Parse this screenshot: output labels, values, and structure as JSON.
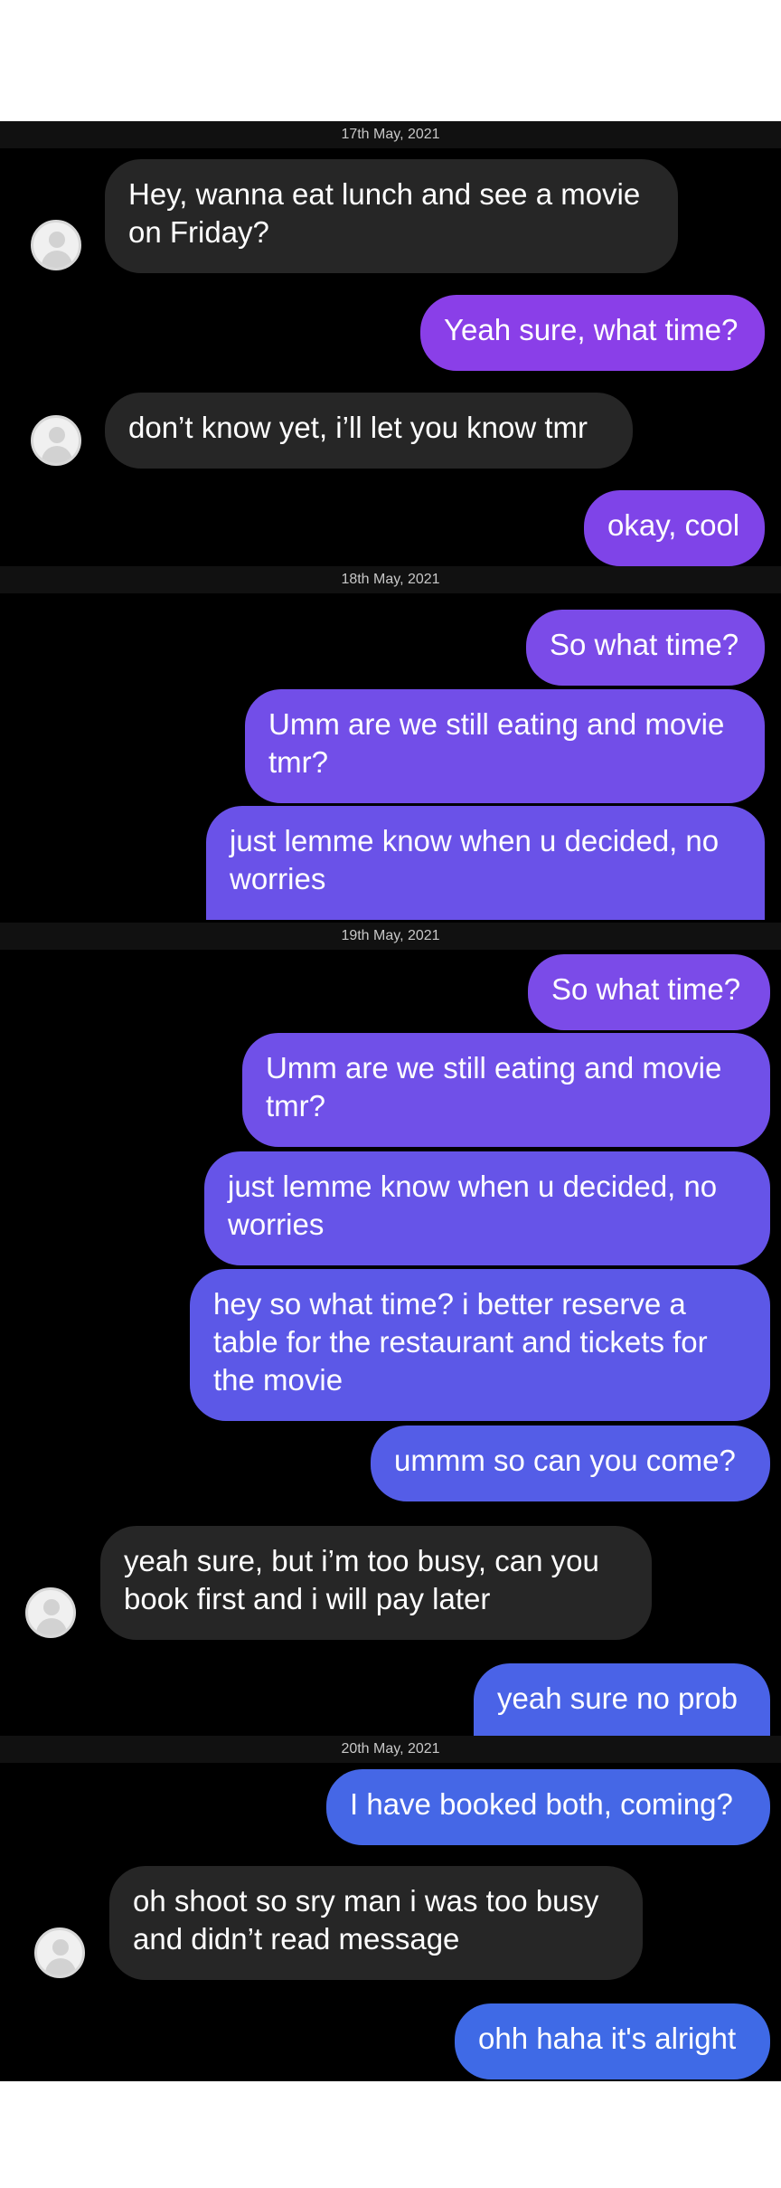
{
  "dates": {
    "d1": "17th May, 2021",
    "d2": "18th May, 2021",
    "d3": "19th May, 2021",
    "d4": "20th May, 2021"
  },
  "messages": {
    "m1": "Hey, wanna eat lunch and see a movie on Friday?",
    "m2": "Yeah sure, what time?",
    "m3": "don’t know yet, i’ll let you know tmr",
    "m4": "okay, cool",
    "m5": "So what time?",
    "m6": "Umm are we still eating and movie tmr?",
    "m7": "just lemme know when u decided, no worries",
    "m8": "So what time?",
    "m9": "Umm are we still eating and movie tmr?",
    "m10": "just lemme know when u decided, no worries",
    "m11": "hey so what time? i better reserve a table for the restaurant and tickets for the movie",
    "m12": "ummm so can you come?",
    "m13": "yeah sure, but i’m too busy, can you book first and i will pay later",
    "m14": "yeah sure no prob",
    "m15": "I have booked both, coming?",
    "m16": "oh shoot so sry man i was too busy and didn’t read message",
    "m17": "ohh haha it's alright"
  },
  "colors": {
    "background": "#000000",
    "incoming_bubble": "#262626",
    "outgoing_top": "#8a3fe8",
    "outgoing_bottom": "#3f6ae6",
    "date_text": "#c8c8c8"
  },
  "icons": {
    "avatar": "user-avatar-icon"
  }
}
